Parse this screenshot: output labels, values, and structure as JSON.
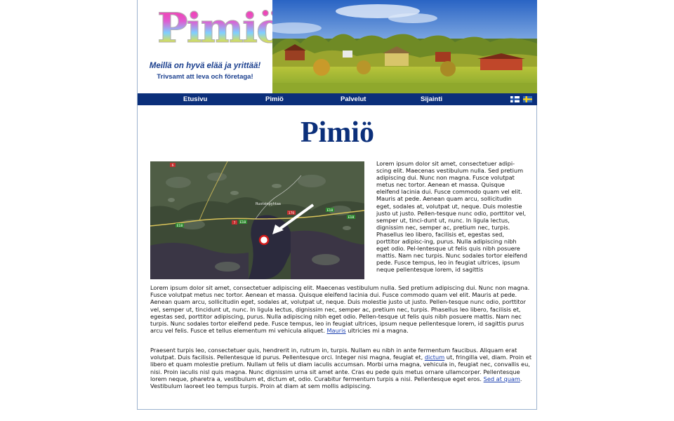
{
  "header": {
    "logo_text": "Pimiö",
    "slogan_fi": "Meillä on hyvä elää ja yrittää!",
    "slogan_sv": "Trivsamt att leva och företaga!"
  },
  "nav": {
    "items": [
      {
        "label": "Etusivu"
      },
      {
        "label": "Pimiö"
      },
      {
        "label": "Palvelut"
      },
      {
        "label": "Sijainti"
      }
    ],
    "flags": [
      "finnish-flag-icon",
      "swedish-flag-icon"
    ]
  },
  "main": {
    "title": "Pimiö",
    "side_text": "Lorem ipsum dolor sit amet, consectetuer adipi-scing elit. Maecenas vestibulum nulla. Sed pretium adipiscing dui. Nunc non magna. Fusce volutpat metus nec tortor. Aenean et massa. Quisque eleifend lacinia dui. Fusce commodo quam vel elit. Mauris at pede. Aenean quam arcu, sollicitudin eget, sodales at, volutpat ut, neque. Duis molestie justo ut justo. Pellen-tesque nunc odio, porttitor vel, semper ut, tinci-dunt ut, nunc. In ligula lectus, dignissim nec, semper ac, pretium nec, turpis. Phasellus leo libero, facilisis et, egestas sed, porttitor adipisc-ing, purus. Nulla adipiscing nibh eget odio. Pel-lentesque ut felis quis nibh posuere mattis. Nam nec turpis. Nunc sodales tortor eleifend pede. Fusce tempus, leo in feugiat ultrices, ipsum neque pellentesque lorem, id sagittis",
    "para1_text": "Lorem ipsum dolor sit amet, consectetuer adipiscing elit. Maecenas vestibulum nulla. Sed pretium adipiscing dui. Nunc non magna. Fusce volutpat metus nec tortor. Aenean et massa. Quisque eleifend lacinia dui. Fusce commodo quam vel elit. Mauris at pede. Aenean quam arcu, sollicitudin eget, sodales at, volutpat ut, neque. Duis molestie justo ut justo. Pellen-tesque nunc odio, porttitor vel, semper ut, tincidunt ut, nunc. In ligula lectus, dignissim nec, semper ac, pretium nec, turpis. Phasellus leo libero, facilisis et, egestas sed, porttitor adipiscing, purus. Nulla adipiscing nibh eget odio. Pellen-tesque ut felis quis nibh posuere mattis. Nam nec turpis. Nunc sodales tortor eleifend pede. Fusce tempus, leo in feugiat ultrices, ipsum neque pellentesque lorem, id sagittis purus arcu vel felis. Fusce et tellus elementum mi vehicula aliquet.",
    "para1_link": "Mauris",
    "para1_tail": " ultricies mi a magna.",
    "para2_a": "Praesent turpis leo, consectetuer quis, hendrerit in, rutrum in, turpis. Nullam eu nibh in ante fermentum faucibus. Aliquam erat volutpat. Duis facilisis. Pellentesque id purus. Pellentesque orci. Integer nisi magna, feugiat et, ",
    "para2_link1": "dictum",
    "para2_b": " ut, fringilla vel, diam. Proin et libero et quam molestie pretium. Nullam ut felis ut diam iaculis accumsan. Morbi urna magna, vehicula in, feugiat nec, convallis eu, nisi. Proin iaculis nisl quis magna. Nunc dignissim urna sit amet ante. Cras eu pede quis metus ornare ullamcorper. Pellentesque lorem neque, pharetra a, vestibulum et, dictum et, odio. Curabitur fermentum turpis a nisi. Pellentesque eget eros. ",
    "para2_link2": "Sed at quam",
    "para2_c": ". Vestibulum laoreet leo tempus turpis. Proin at diam at sem mollis adipiscing."
  },
  "map": {
    "place_label": "Ruotsinpyhtaa",
    "road_labels": [
      "6",
      "170",
      "7",
      "E18",
      "E18",
      "E18",
      "E18"
    ]
  },
  "colors": {
    "nav_bg": "#0b2f7a",
    "title": "#0b2f7a",
    "link": "#1a3fb0",
    "border": "#9db3cf"
  }
}
